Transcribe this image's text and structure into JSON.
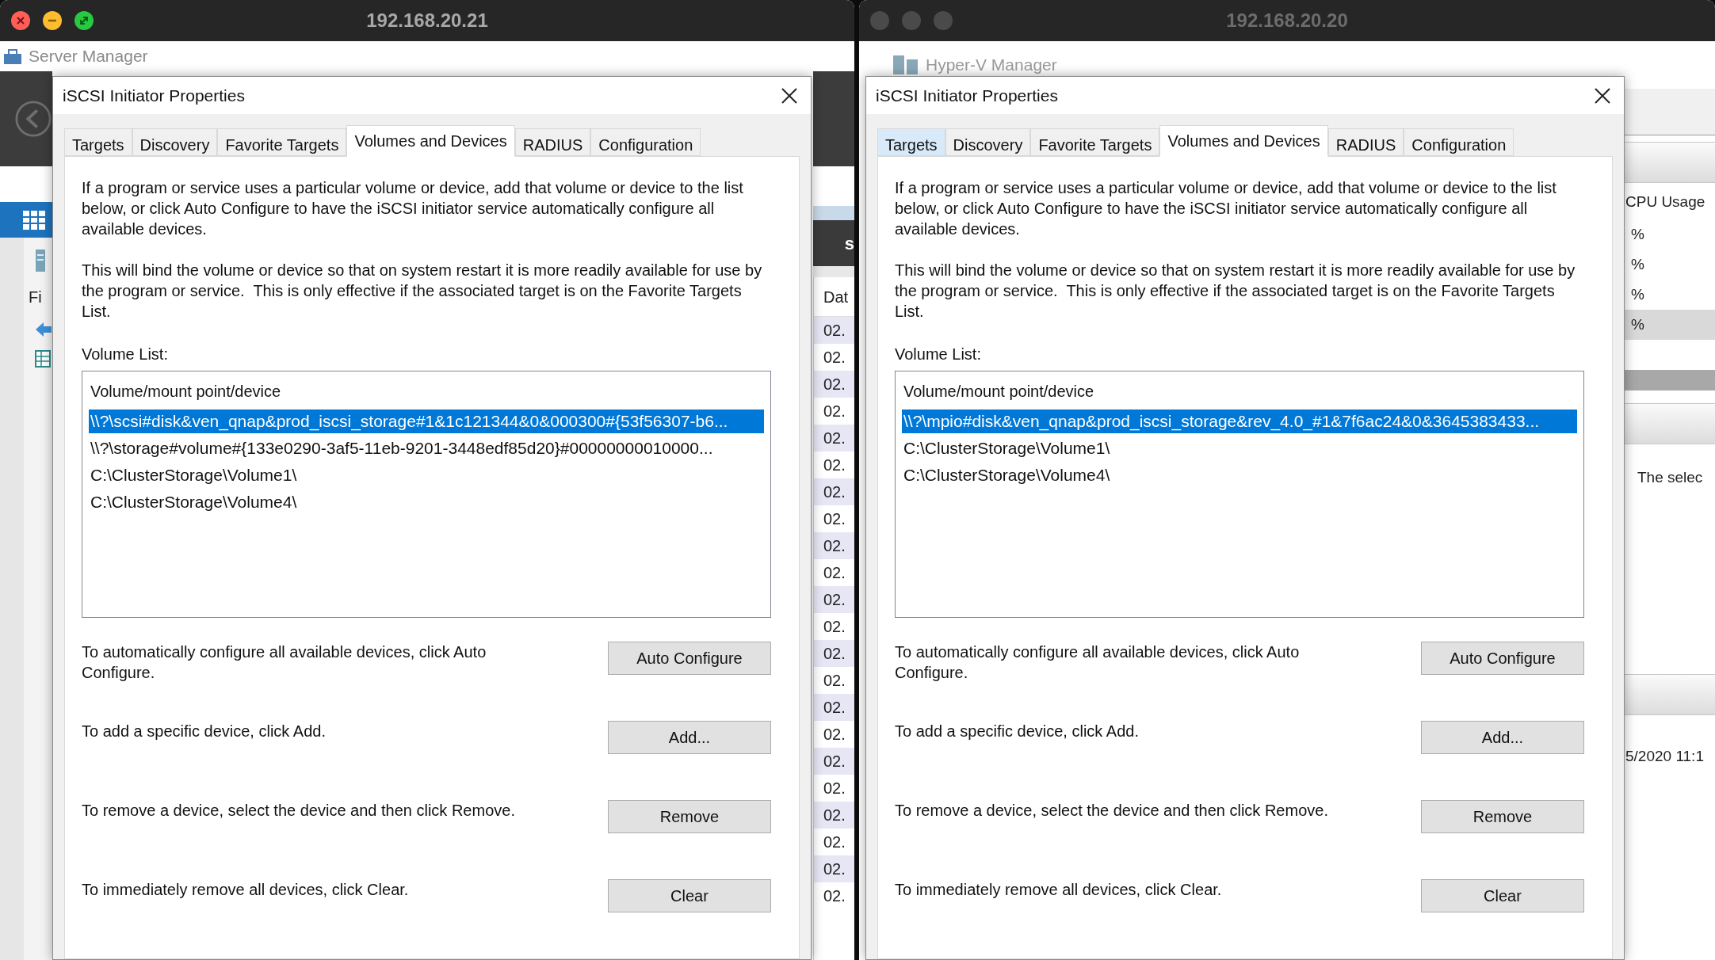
{
  "windows": [
    {
      "title": "192.168.20.21",
      "focused": true,
      "background": {
        "kind": "server-manager",
        "app_title": "Server Manager",
        "nav_label": "Fi",
        "header_fragment": "s",
        "column_header": "Dat",
        "cells": [
          "02.",
          "02.",
          "02.",
          "02.",
          "02.",
          "02.",
          "02.",
          "02.",
          "02.",
          "02.",
          "02.",
          "02.",
          "02.",
          "02.",
          "02.",
          "02.",
          "02.",
          "02.",
          "02.",
          "02.",
          "02.",
          "02."
        ]
      },
      "dialog": {
        "title": "iSCSI Initiator Properties",
        "tabs": [
          {
            "label": "Targets",
            "selected": false,
            "hovered": false
          },
          {
            "label": "Discovery",
            "selected": false,
            "hovered": false
          },
          {
            "label": "Favorite Targets",
            "selected": false,
            "hovered": false
          },
          {
            "label": "Volumes and Devices",
            "selected": true,
            "hovered": false
          },
          {
            "label": "RADIUS",
            "selected": false,
            "hovered": false
          },
          {
            "label": "Configuration",
            "selected": false,
            "hovered": false
          }
        ],
        "intro": "If a program or service uses a particular volume or device, add that volume or device to the list below, or click Auto Configure to have the iSCSI initiator service automatically configure all available devices.",
        "binding_note": "This will bind the volume or device so that on system restart it is more readily available for use by the program or service.  This is only effective if the associated target is on the Favorite Targets List.",
        "list_label": "Volume List:",
        "list_header": "Volume/mount point/device",
        "volumes": [
          {
            "path": "\\\\?\\scsi#disk&ven_qnap&prod_iscsi_storage#1&1c121344&0&000300#{53f56307-b6...",
            "selected": true
          },
          {
            "path": "\\\\?\\storage#volume#{133e0290-3af5-11eb-9201-3448edf85d20}#00000000010000...",
            "selected": false
          },
          {
            "path": "C:\\ClusterStorage\\Volume1\\",
            "selected": false
          },
          {
            "path": "C:\\ClusterStorage\\Volume4\\",
            "selected": false
          }
        ],
        "actions": [
          {
            "description": "To automatically configure all available devices, click Auto Configure.",
            "button": "Auto Configure"
          },
          {
            "description": "To add a specific device, click Add.",
            "button": "Add..."
          },
          {
            "description": "To remove a device, select the device and then click Remove.",
            "button": "Remove"
          },
          {
            "description": "To immediately remove all devices, click Clear.",
            "button": "Clear"
          }
        ]
      }
    },
    {
      "title": "192.168.20.20",
      "focused": false,
      "background": {
        "kind": "hyper-v",
        "app_title": "Hyper-V Manager",
        "column_header": "CPU Usage",
        "cells": [
          {
            "text": "%",
            "selected": false
          },
          {
            "text": "%",
            "selected": false
          },
          {
            "text": "%",
            "selected": false
          },
          {
            "text": "%",
            "selected": true
          }
        ],
        "pane_text": "The selec",
        "date_fragment": "5/2020 11:1"
      },
      "dialog": {
        "title": "iSCSI Initiator Properties",
        "tabs": [
          {
            "label": "Targets",
            "selected": false,
            "hovered": true
          },
          {
            "label": "Discovery",
            "selected": false,
            "hovered": false
          },
          {
            "label": "Favorite Targets",
            "selected": false,
            "hovered": false
          },
          {
            "label": "Volumes and Devices",
            "selected": true,
            "hovered": false
          },
          {
            "label": "RADIUS",
            "selected": false,
            "hovered": false
          },
          {
            "label": "Configuration",
            "selected": false,
            "hovered": false
          }
        ],
        "intro": "If a program or service uses a particular volume or device, add that volume or device to the list below, or click Auto Configure to have the iSCSI initiator service automatically configure all available devices.",
        "binding_note": "This will bind the volume or device so that on system restart it is more readily available for use by the program or service.  This is only effective if the associated target is on the Favorite Targets List.",
        "list_label": "Volume List:",
        "list_header": "Volume/mount point/device",
        "volumes": [
          {
            "path": "\\\\?\\mpio#disk&ven_qnap&prod_iscsi_storage&rev_4.0_#1&7f6ac24&0&3645383433...",
            "selected": true
          },
          {
            "path": "C:\\ClusterStorage\\Volume1\\",
            "selected": false
          },
          {
            "path": "C:\\ClusterStorage\\Volume4\\",
            "selected": false
          }
        ],
        "actions": [
          {
            "description": "To automatically configure all available devices, click Auto Configure.",
            "button": "Auto Configure"
          },
          {
            "description": "To add a specific device, click Add.",
            "button": "Add..."
          },
          {
            "description": "To remove a device, select the device and then click Remove.",
            "button": "Remove"
          },
          {
            "description": "To immediately remove all devices, click Clear.",
            "button": "Clear"
          }
        ]
      }
    }
  ]
}
